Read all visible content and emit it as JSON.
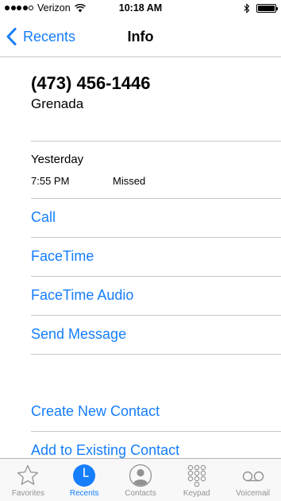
{
  "status_bar": {
    "carrier": "Verizon",
    "signal_bars": 4,
    "signal_total": 5,
    "time": "10:18 AM",
    "battery_level": 1.0
  },
  "nav": {
    "back_label": "Recents",
    "title": "Info"
  },
  "contact": {
    "number": "(473) 456-1446",
    "location": "Grenada"
  },
  "call_log": {
    "date": "Yesterday",
    "time": "7:55 PM",
    "status": "Missed"
  },
  "actions": {
    "call": "Call",
    "facetime": "FaceTime",
    "facetime_audio": "FaceTime Audio",
    "send_message": "Send Message",
    "create_contact": "Create New Contact",
    "add_existing": "Add to Existing Contact"
  },
  "tabs": [
    {
      "label": "Favorites",
      "icon": "star-icon",
      "active": false
    },
    {
      "label": "Recents",
      "icon": "clock-icon",
      "active": true
    },
    {
      "label": "Contacts",
      "icon": "person-icon",
      "active": false
    },
    {
      "label": "Keypad",
      "icon": "keypad-icon",
      "active": false
    },
    {
      "label": "Voicemail",
      "icon": "voicemail-icon",
      "active": false
    }
  ],
  "colors": {
    "accent": "#157efb",
    "separator": "#c8c7cc",
    "tab_inactive": "#929292"
  }
}
